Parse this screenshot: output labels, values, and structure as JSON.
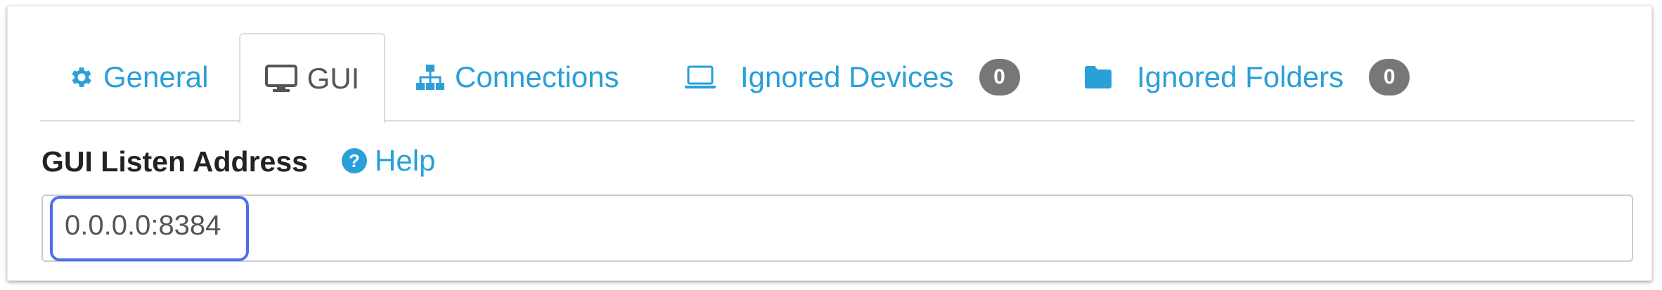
{
  "tabs": [
    {
      "label": "General",
      "icon": "gear-icon"
    },
    {
      "label": "GUI",
      "icon": "monitor-icon",
      "active": true
    },
    {
      "label": "Connections",
      "icon": "sitemap-icon"
    },
    {
      "label": "Ignored Devices",
      "icon": "laptop-icon",
      "badge": "0"
    },
    {
      "label": "Ignored Folders",
      "icon": "folder-icon",
      "badge": "0"
    }
  ],
  "gui": {
    "listen_address_label": "GUI Listen Address",
    "help_label": "Help",
    "listen_address_value": "0.0.0.0:8384"
  },
  "colors": {
    "link": "#2a9fd8",
    "active_tab_text": "#555555",
    "badge_bg": "#777777",
    "highlight": "#4a6ff0"
  }
}
